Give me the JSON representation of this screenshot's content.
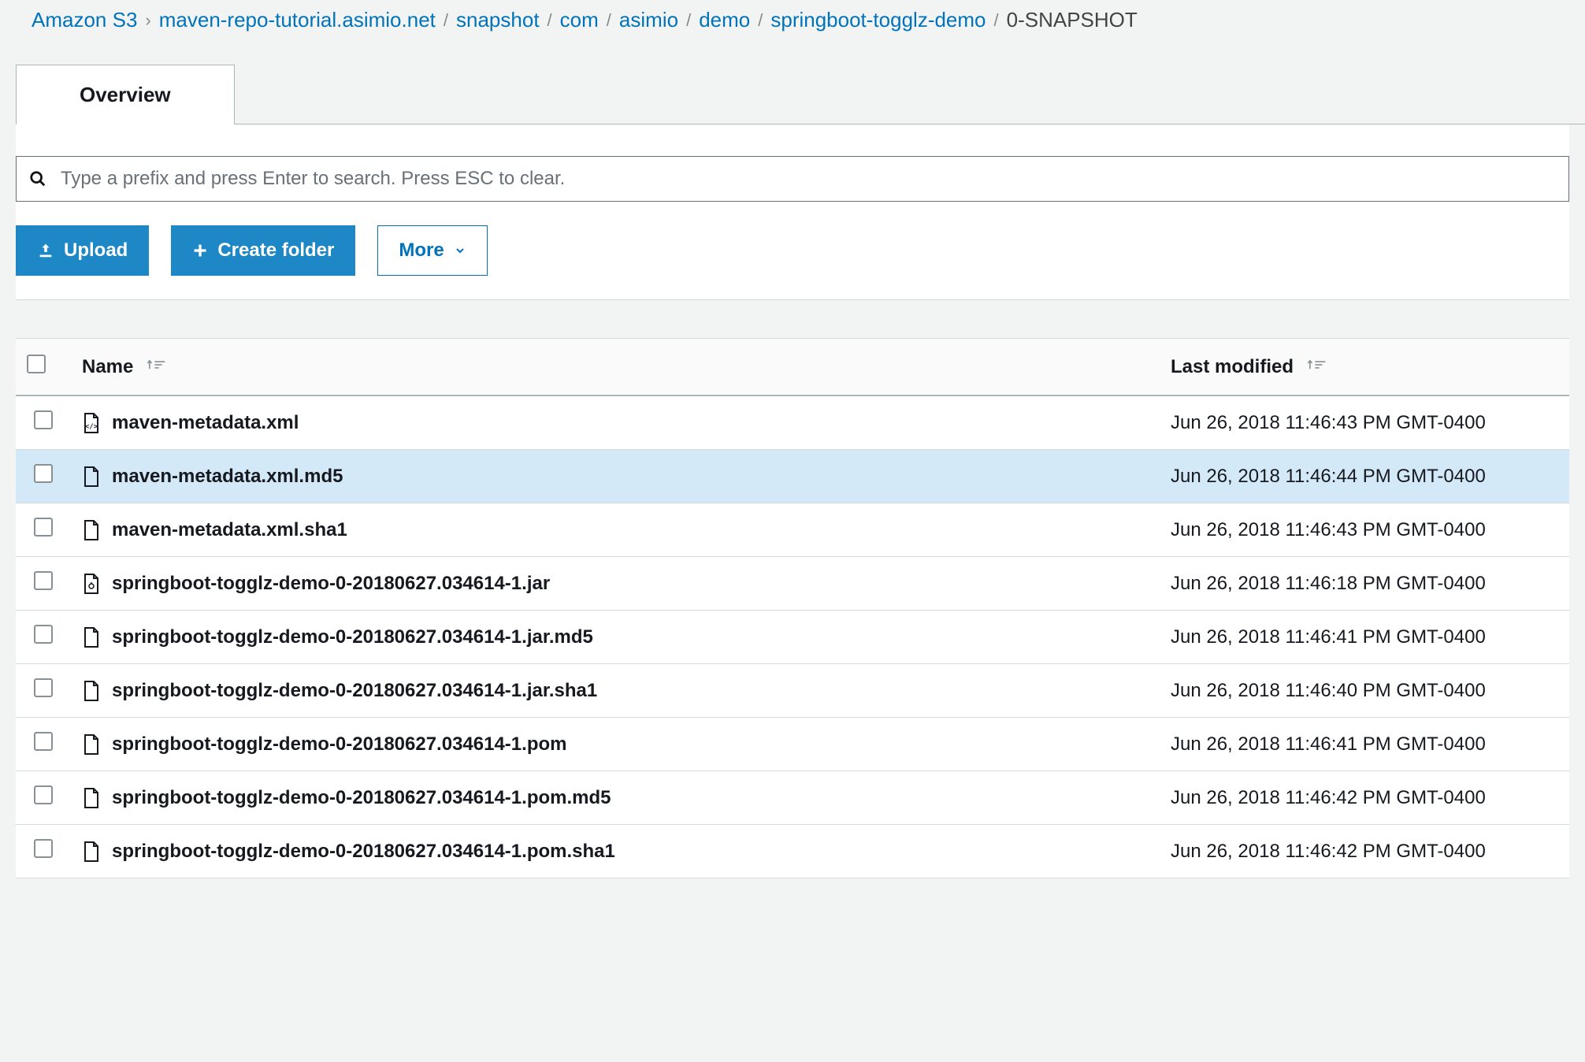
{
  "breadcrumb": [
    {
      "label": "Amazon S3",
      "sep": "chevron"
    },
    {
      "label": "maven-repo-tutorial.asimio.net",
      "sep": "slash"
    },
    {
      "label": "snapshot",
      "sep": "slash"
    },
    {
      "label": "com",
      "sep": "slash"
    },
    {
      "label": "asimio",
      "sep": "slash"
    },
    {
      "label": "demo",
      "sep": "slash"
    },
    {
      "label": "springboot-togglz-demo",
      "sep": "slash"
    },
    {
      "label": "0-SNAPSHOT",
      "current": true
    }
  ],
  "tabs": {
    "overview": "Overview"
  },
  "search": {
    "placeholder": "Type a prefix and press Enter to search. Press ESC to clear."
  },
  "actions": {
    "upload": "Upload",
    "create_folder": "Create folder",
    "more": "More"
  },
  "table": {
    "headers": {
      "name": "Name",
      "last_modified": "Last modified"
    },
    "rows": [
      {
        "icon": "xml",
        "name": "maven-metadata.xml",
        "modified": "Jun 26, 2018 11:46:43 PM GMT-0400"
      },
      {
        "icon": "file",
        "name": "maven-metadata.xml.md5",
        "modified": "Jun 26, 2018 11:46:44 PM GMT-0400",
        "highlight": true
      },
      {
        "icon": "file",
        "name": "maven-metadata.xml.sha1",
        "modified": "Jun 26, 2018 11:46:43 PM GMT-0400"
      },
      {
        "icon": "jar",
        "name": "springboot-togglz-demo-0-20180627.034614-1.jar",
        "modified": "Jun 26, 2018 11:46:18 PM GMT-0400"
      },
      {
        "icon": "file",
        "name": "springboot-togglz-demo-0-20180627.034614-1.jar.md5",
        "modified": "Jun 26, 2018 11:46:41 PM GMT-0400"
      },
      {
        "icon": "file",
        "name": "springboot-togglz-demo-0-20180627.034614-1.jar.sha1",
        "modified": "Jun 26, 2018 11:46:40 PM GMT-0400"
      },
      {
        "icon": "file",
        "name": "springboot-togglz-demo-0-20180627.034614-1.pom",
        "modified": "Jun 26, 2018 11:46:41 PM GMT-0400"
      },
      {
        "icon": "file",
        "name": "springboot-togglz-demo-0-20180627.034614-1.pom.md5",
        "modified": "Jun 26, 2018 11:46:42 PM GMT-0400"
      },
      {
        "icon": "file",
        "name": "springboot-togglz-demo-0-20180627.034614-1.pom.sha1",
        "modified": "Jun 26, 2018 11:46:42 PM GMT-0400"
      }
    ]
  }
}
